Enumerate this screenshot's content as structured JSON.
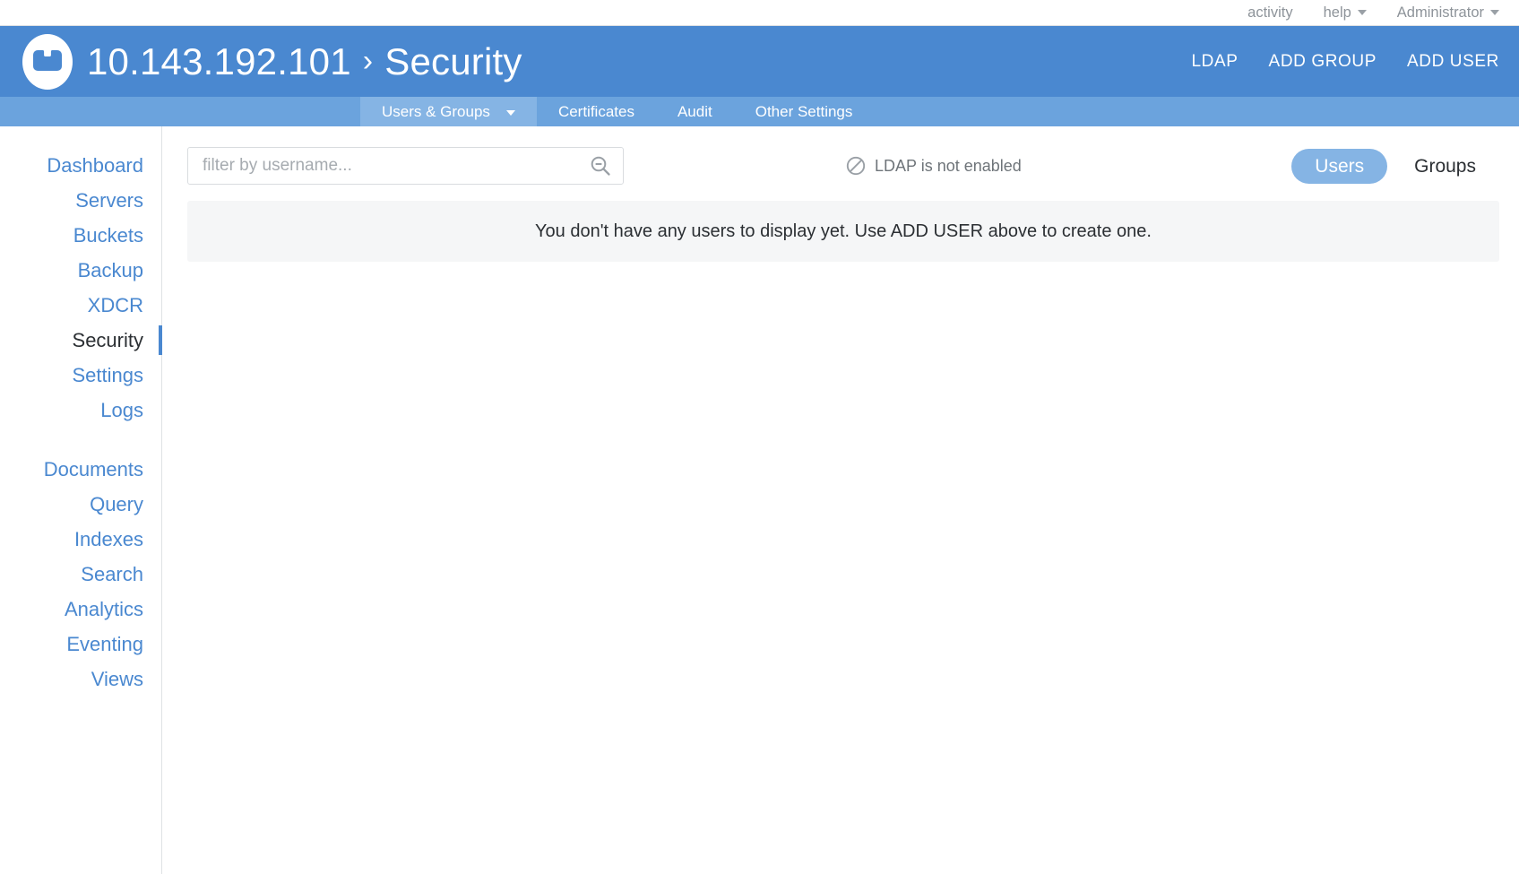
{
  "utility_bar": {
    "items": [
      {
        "label": "activity",
        "has_caret": false
      },
      {
        "label": "help",
        "has_caret": true
      },
      {
        "label": "Administrator",
        "has_caret": true
      }
    ]
  },
  "header": {
    "logo_name": "couchbase-logo",
    "cluster_address": "10.143.192.101",
    "separator": "›",
    "section": "Security",
    "actions": [
      {
        "label": "LDAP",
        "name": "ldap-button"
      },
      {
        "label": "ADD GROUP",
        "name": "add-group-button"
      },
      {
        "label": "ADD USER",
        "name": "add-user-button"
      }
    ],
    "background_color": "#4a88d0"
  },
  "subnav": {
    "active_color": "#85b4e4",
    "background_color": "#6ba3dd",
    "tabs": [
      {
        "label": "Users & Groups",
        "active": true,
        "has_chevron": true
      },
      {
        "label": "Certificates",
        "active": false,
        "has_chevron": false
      },
      {
        "label": "Audit",
        "active": false,
        "has_chevron": false
      },
      {
        "label": "Other Settings",
        "active": false,
        "has_chevron": false
      }
    ]
  },
  "sidebar": {
    "link_color": "#4a88d0",
    "active_color": "#2b2f33",
    "group_one": [
      {
        "label": "Dashboard",
        "active": false
      },
      {
        "label": "Servers",
        "active": false
      },
      {
        "label": "Buckets",
        "active": false
      },
      {
        "label": "Backup",
        "active": false
      },
      {
        "label": "XDCR",
        "active": false
      },
      {
        "label": "Security",
        "active": true
      },
      {
        "label": "Settings",
        "active": false
      },
      {
        "label": "Logs",
        "active": false
      }
    ],
    "group_two": [
      {
        "label": "Documents",
        "active": false
      },
      {
        "label": "Query",
        "active": false
      },
      {
        "label": "Indexes",
        "active": false
      },
      {
        "label": "Search",
        "active": false
      },
      {
        "label": "Analytics",
        "active": false
      },
      {
        "label": "Eventing",
        "active": false
      },
      {
        "label": "Views",
        "active": false
      }
    ]
  },
  "main": {
    "filter": {
      "value": "",
      "placeholder": "filter by username...",
      "icon": "search-zoom-out-icon"
    },
    "ldap_status": {
      "icon": "prohibited-icon",
      "text": "LDAP is not enabled"
    },
    "toggle": {
      "options": [
        {
          "label": "Users",
          "active": true
        },
        {
          "label": "Groups",
          "active": false
        }
      ]
    },
    "empty_state": {
      "message": "You don't have any users to display yet. Use ADD USER above to create one.",
      "background_color": "#f5f6f7"
    }
  }
}
